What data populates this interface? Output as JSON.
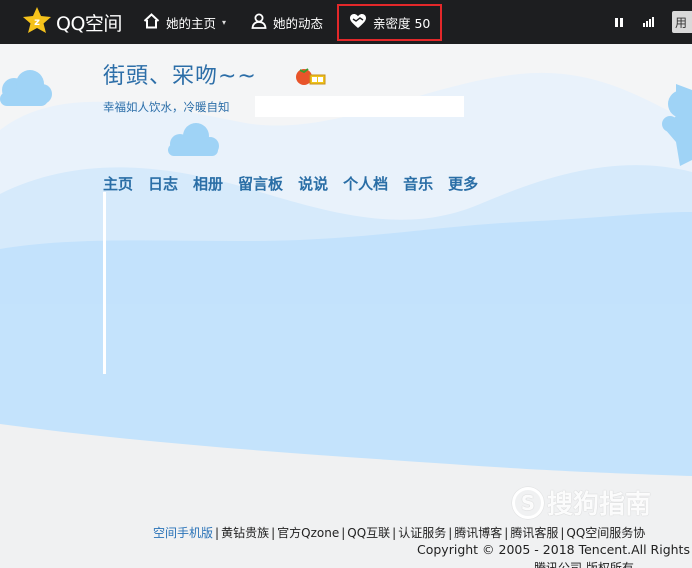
{
  "topbar": {
    "logo_text": "QQ空间",
    "home_label": "她的主页",
    "feed_label": "她的动态",
    "intimacy_label": "亲密度 50",
    "user_label": "用"
  },
  "profile": {
    "title": "街頭、冞吻~~",
    "subtitle": "幸福如人饮水，冷暖自知"
  },
  "main_nav": [
    "主页",
    "日志",
    "相册",
    "留言板",
    "说说",
    "个人档",
    "音乐",
    "更多"
  ],
  "footer": {
    "links": [
      "空间手机版",
      "黄钻贵族",
      "官方Qzone",
      "QQ互联",
      "认证服务",
      "腾讯博客",
      "腾讯客服",
      "QQ空间服务协"
    ],
    "copyright": "Copyright © 2005 - 2018 Tencent.All Rights",
    "company": "腾讯公司 版权所有"
  },
  "watermark": {
    "letter": "S",
    "text": "搜狗指南"
  },
  "colors": {
    "topbar_bg": "#1d1e20",
    "highlight_border": "#e3282a",
    "title_blue": "#2c6ea8",
    "sky_light": "#e6f1fb",
    "sky_wave": "#bde0fb"
  },
  "icons": {
    "logo": "qq-star-icon",
    "home": "home-icon",
    "feed": "person-icon",
    "intimacy": "heart-icon",
    "pause": "pause-icon",
    "signal": "signal-icon",
    "title": "tomato-icon"
  }
}
